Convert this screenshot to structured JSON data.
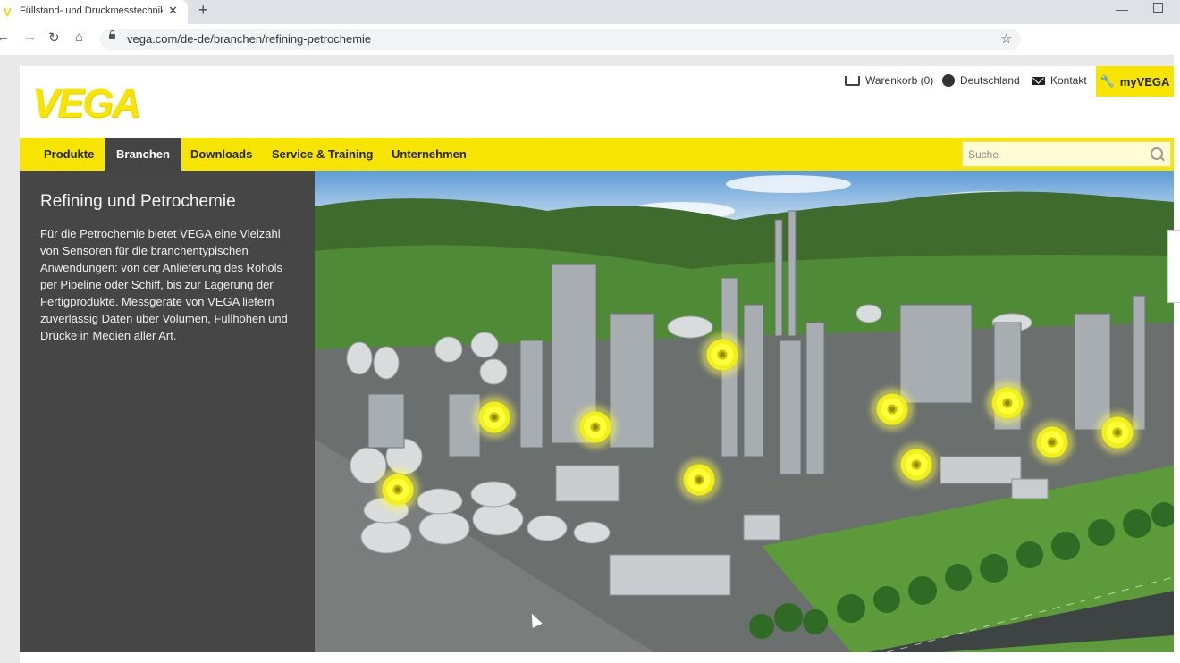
{
  "browser": {
    "tab_title": "Füllstand- und Druckmesstechnik",
    "tab_favicon": "V",
    "url": "vega.com/de-de/branchen/refining-petrochemie"
  },
  "header": {
    "logo": "VEGA",
    "cart": "Warenkorb (0)",
    "country": "Deutschland",
    "contact": "Kontakt",
    "account": "myVEGA"
  },
  "nav": {
    "items": [
      "Produkte",
      "Branchen",
      "Downloads",
      "Service & Training",
      "Unternehmen"
    ],
    "active": "Branchen",
    "search_placeholder": "Suche"
  },
  "panel": {
    "title": "Refining und Petrochemie",
    "text": "Für die Petrochemie bietet VEGA eine Vielzahl von Sensoren für die branchentypischen Anwendungen: von der Anlieferung des Rohöls per Pipeline oder Schiff, bis zur Lagerung der Fertigprodukte. Messgeräte von VEGA liefern zuverlässig Daten über Volumen, Füllhöhen und Drücke in Medien aller Art."
  },
  "colors": {
    "brand_yellow": "#f7e400",
    "panel_gray": "#464646",
    "active_nav": "#444444"
  }
}
